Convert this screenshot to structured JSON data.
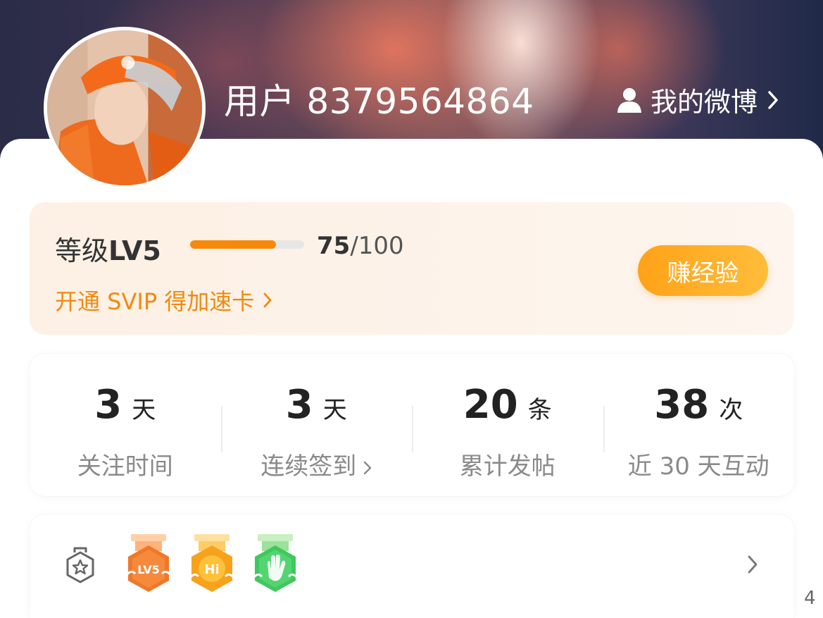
{
  "header": {
    "username": "用户 8379564864",
    "my_weibo_label": "我的微博"
  },
  "level": {
    "label_prefix": "等级",
    "label_level": "LV5",
    "progress_current": "75",
    "progress_max": "/100",
    "progress_fraction": 0.75,
    "svip_link": "开通 SVIP 得加速卡",
    "earn_button": "赚经验"
  },
  "stats": [
    {
      "num": "3",
      "unit": "天",
      "label": "关注时间",
      "has_link": false
    },
    {
      "num": "3",
      "unit": "天",
      "label": "连续签到",
      "has_link": true
    },
    {
      "num": "20",
      "unit": "条",
      "label": "累计发帖",
      "has_link": false
    },
    {
      "num": "38",
      "unit": "次",
      "label": "近 30 天互动",
      "has_link": false
    }
  ],
  "badges": {
    "items": [
      {
        "name": "lv5-medal-icon",
        "text": "LV5",
        "color": "#f0782a"
      },
      {
        "name": "hi-medal-icon",
        "text": "Hi",
        "color": "#f7a21c"
      },
      {
        "name": "wave-hand-medal-icon",
        "text": "",
        "color": "#3ec85e"
      }
    ]
  },
  "colors": {
    "accent_orange": "#f08a10",
    "progress_fill": "#f7890a",
    "button_gradient_start": "#ffa218",
    "button_gradient_end": "#ffbd3a"
  },
  "page_indicator": "4"
}
